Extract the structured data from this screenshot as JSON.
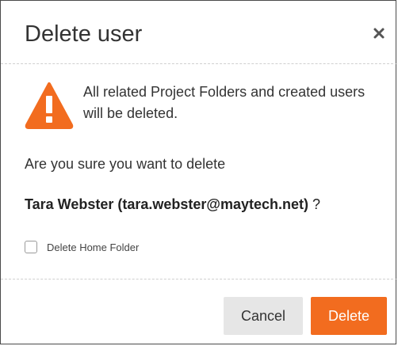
{
  "dialog": {
    "title": "Delete user",
    "close_icon": "close-icon",
    "warning": {
      "icon": "warning-icon",
      "icon_color": "#f26c1f",
      "text": "All related Project Folders and created users will be deleted."
    },
    "question": "Are you sure you want to delete",
    "target": {
      "user": "Tara Webster (tara.webster@maytech.net)",
      "suffix": "?"
    },
    "delete_home_folder": {
      "label": "Delete Home Folder",
      "checked": false
    },
    "buttons": {
      "cancel_label": "Cancel",
      "delete_label": "Delete",
      "delete_color": "#f26c1f",
      "cancel_color": "#e6e6e6"
    }
  }
}
